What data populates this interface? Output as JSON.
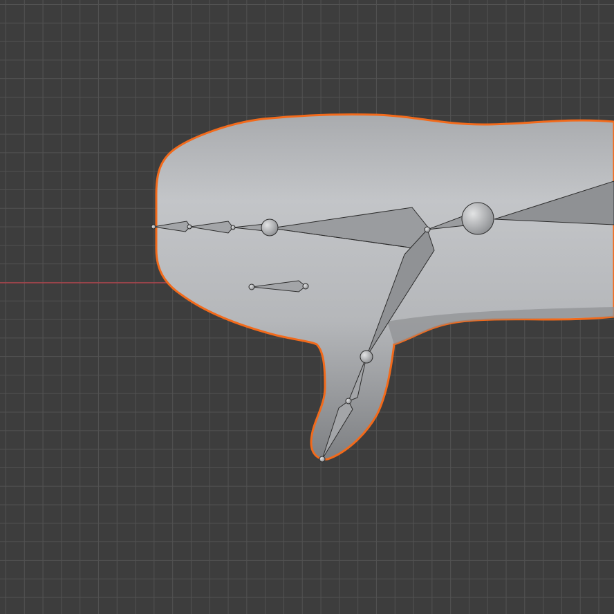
{
  "viewport": {
    "background": "#3d3d3d",
    "grid_color": "#525252",
    "x_axis_color": "#c1404a",
    "selection_outline_color": "#f26a1b",
    "mesh_color": "#b4b6b9"
  },
  "scene": {
    "object_type": "whale-mesh",
    "armature_bones": 8
  }
}
